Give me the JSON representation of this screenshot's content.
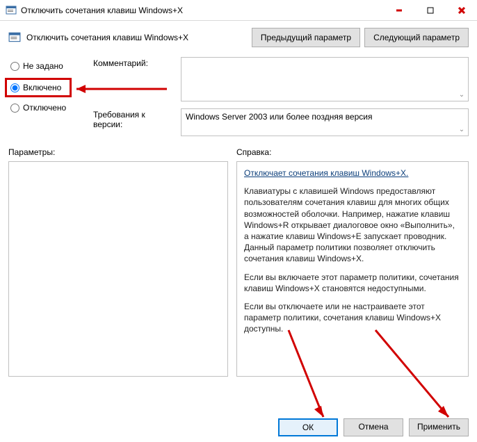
{
  "window": {
    "title": "Отключить сочетания клавиш Windows+X"
  },
  "header": {
    "title": "Отключить сочетания клавиш Windows+X",
    "prev": "Предыдущий параметр",
    "next": "Следующий параметр"
  },
  "state": {
    "not_configured": "Не задано",
    "enabled": "Включено",
    "disabled": "Отключено",
    "selected": "enabled"
  },
  "fields": {
    "comment_label": "Комментарий:",
    "comment_value": "",
    "requirements_label": "Требования к версии:",
    "requirements_value": "Windows Server 2003 или более поздняя версия"
  },
  "sections": {
    "options_label": "Параметры:",
    "help_label": "Справка:"
  },
  "help": {
    "title": "Отключает сочетания клавиш Windows+X.",
    "p1": "Клавиатуры с клавишей Windows предоставляют пользователям сочетания клавиш для многих общих возможностей оболочки. Например, нажатие клавиш Windows+R открывает диалоговое окно «Выполнить», а нажатие клавиш Windows+E запускает проводник. Данный параметр политики позволяет отключить сочетания клавиш Windows+X.",
    "p2": "Если вы включаете этот параметр политики, сочетания клавиш Windows+X становятся недоступными.",
    "p3": "Если вы отключаете или не настраиваете этот параметр политики, сочетания клавиш Windows+X доступны."
  },
  "buttons": {
    "ok": "ОК",
    "cancel": "Отмена",
    "apply": "Применить"
  }
}
